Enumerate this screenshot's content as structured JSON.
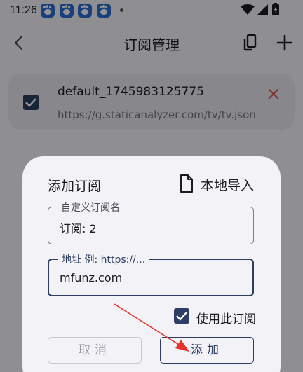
{
  "status_bar": {
    "time": "11:26",
    "notification_icons": [
      "baidu-icon",
      "baidu-icon",
      "baidu-icon",
      "baidu-icon"
    ],
    "indicators": [
      "wifi-icon",
      "signal-icon",
      "battery-icon"
    ]
  },
  "app_bar": {
    "title": "订阅管理",
    "back_icon": "back-arrow-icon",
    "actions": [
      "clipboard-icon",
      "plus-icon"
    ]
  },
  "subscription": {
    "name": "default_1745983125775",
    "url": "https://g.staticanalyzer.com/tv/tv.json",
    "checked": true,
    "delete_icon": "close-icon"
  },
  "dialog": {
    "title": "添加订阅",
    "import_label": "本地导入",
    "name_field": {
      "label": "自定义订阅名",
      "value": "订阅: 2"
    },
    "url_field": {
      "label": "地址 例: https://...",
      "value": "mfunz.com"
    },
    "use_checkbox": {
      "label": "使用此订阅",
      "checked": true
    },
    "cancel_label": "取消",
    "add_label": "添加"
  },
  "colors": {
    "accent": "#2d3e63",
    "annotation_arrow": "#e8312a",
    "delete": "#d9534f"
  }
}
